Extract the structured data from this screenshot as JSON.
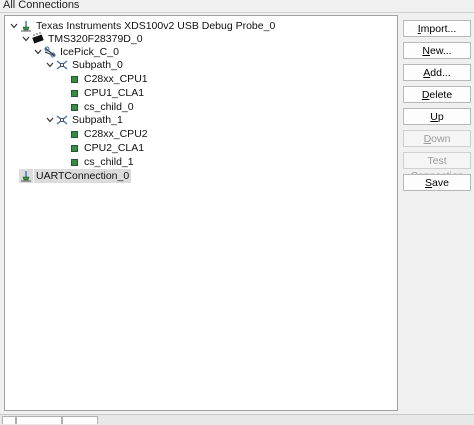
{
  "panel": {
    "title": "All Connections"
  },
  "tree": {
    "nodes": [
      {
        "label": "Texas Instruments XDS100v2 USB Debug Probe_0",
        "icon": "probe-icon",
        "expanded": true
      },
      {
        "label": "TMS320F28379D_0",
        "icon": "chip-icon",
        "expanded": true
      },
      {
        "label": "IcePick_C_0",
        "icon": "router-icon",
        "expanded": true
      },
      {
        "label": "Subpath_0",
        "icon": "subpath-icon",
        "expanded": true
      },
      {
        "label": "C28xx_CPU1",
        "icon": "cpu-icon"
      },
      {
        "label": "CPU1_CLA1",
        "icon": "cpu-icon"
      },
      {
        "label": "cs_child_0",
        "icon": "cpu-icon"
      },
      {
        "label": "Subpath_1",
        "icon": "subpath-icon",
        "expanded": true
      },
      {
        "label": "C28xx_CPU2",
        "icon": "cpu-icon"
      },
      {
        "label": "CPU2_CLA1",
        "icon": "cpu-icon"
      },
      {
        "label": "cs_child_1",
        "icon": "cpu-icon"
      },
      {
        "label": "UARTConnection_0",
        "icon": "connection-icon",
        "selected": true
      }
    ]
  },
  "buttons": {
    "import": {
      "pre": "",
      "u": "I",
      "post": "mport..."
    },
    "new": {
      "pre": "",
      "u": "N",
      "post": "ew..."
    },
    "add": {
      "pre": "",
      "u": "A",
      "post": "dd..."
    },
    "delete": {
      "pre": "",
      "u": "D",
      "post": "elete"
    },
    "up": {
      "pre": "",
      "u": "U",
      "post": "p"
    },
    "down": {
      "pre": "",
      "u": "D",
      "post": "own"
    },
    "test_connection": {
      "label": "Test Connection"
    },
    "save": {
      "pre": "",
      "u": "S",
      "post": "ave"
    }
  }
}
